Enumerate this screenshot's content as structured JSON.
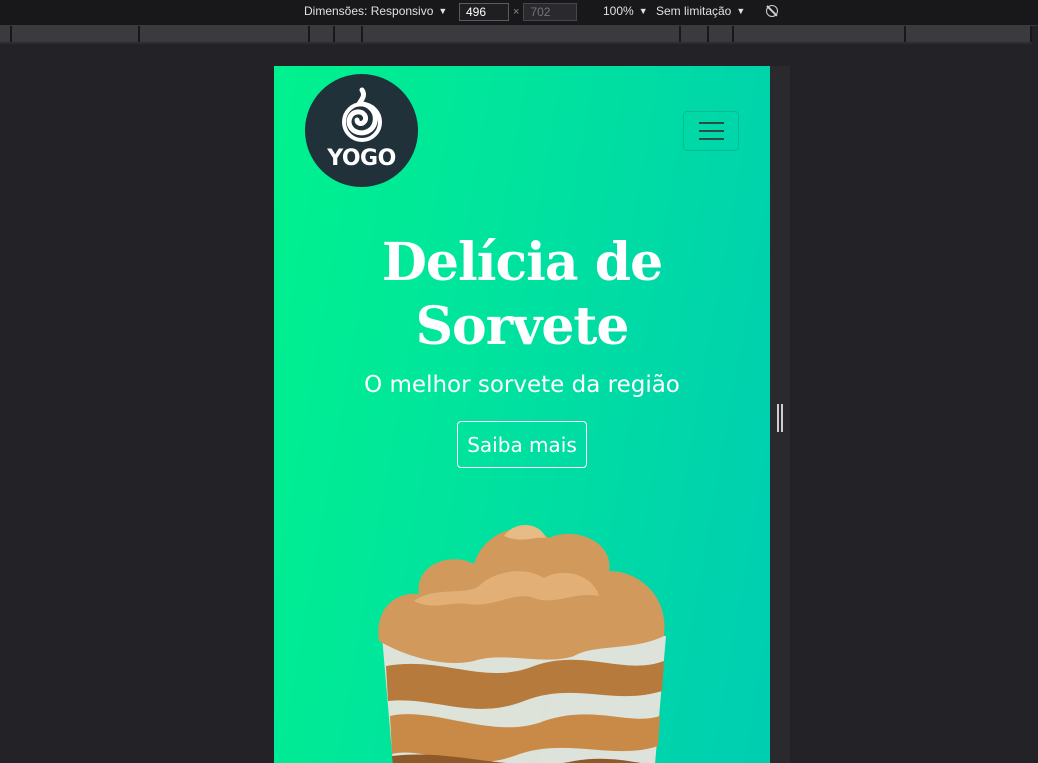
{
  "toolbar": {
    "dimensions_label": "Dimensões: Responsivo",
    "width_value": "496",
    "height_placeholder": "702",
    "times": "×",
    "zoom": "100%",
    "throttle": "Sem limitação",
    "caret": "▼"
  },
  "site": {
    "logo_text": "YOGO",
    "hero_title": "Delícia de Sorvete",
    "hero_subtitle": "O melhor sorvete da região",
    "cta_label": "Saiba mais"
  },
  "colors": {
    "gradient_start": "#00f28e",
    "gradient_end": "#00cdb2",
    "logo_bg": "#20313a"
  }
}
